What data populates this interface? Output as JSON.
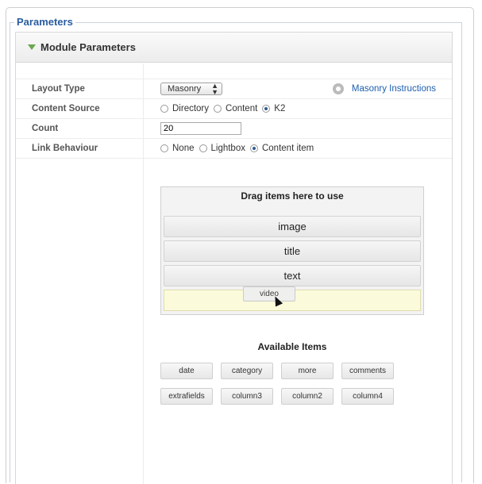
{
  "fieldset": {
    "legend": "Parameters"
  },
  "panel": {
    "title": "Module Parameters"
  },
  "params": {
    "layout_type": {
      "label": "Layout Type",
      "value": "Masonry",
      "link": "Masonry Instructions"
    },
    "content_source": {
      "label": "Content Source",
      "options": [
        "Directory",
        "Content",
        "K2"
      ],
      "selected": "K2"
    },
    "count": {
      "label": "Count",
      "value": "20"
    },
    "link_behaviour": {
      "label": "Link Behaviour",
      "options": [
        "None",
        "Lightbox",
        "Content item"
      ],
      "selected": "Content item"
    }
  },
  "drop_area": {
    "title": "Drag items here to use",
    "items": [
      "image",
      "title",
      "text"
    ],
    "dragging": "video"
  },
  "available": {
    "title": "Available Items",
    "items": [
      "date",
      "category",
      "more",
      "comments",
      "extrafields",
      "column3",
      "column2",
      "column4"
    ]
  },
  "colors": {
    "legend": "#2a5d9f",
    "link": "#1c5fb0",
    "accent": "#6aa84f",
    "placeholder": "#fbfbdc"
  }
}
